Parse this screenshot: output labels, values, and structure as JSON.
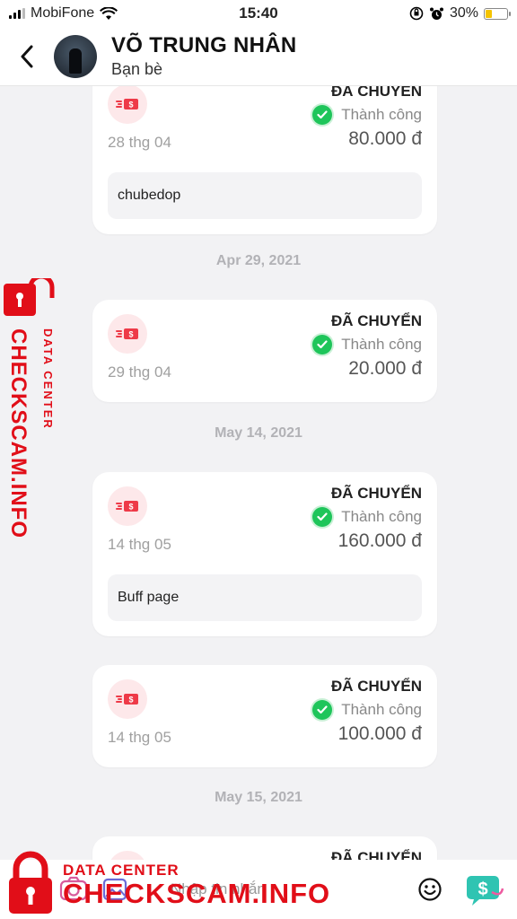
{
  "status_bar": {
    "carrier": "MobiFone",
    "time": "15:40",
    "battery": "30%",
    "battery_level": 0.3
  },
  "header": {
    "back_icon": "chevron-left-icon",
    "name": "VÕ TRUNG NHÂN",
    "relation": "Bạn bè"
  },
  "transactions": [
    {
      "type": "ĐÃ CHUYỂN",
      "status": "Thành công",
      "amount": "80.000 đ",
      "date": "28 thg 04",
      "note": "chubedop"
    },
    {
      "type": "ĐÃ CHUYỂN",
      "status": "Thành công",
      "amount": "20.000 đ",
      "date": "29 thg 04",
      "note": ""
    },
    {
      "type": "ĐÃ CHUYỂN",
      "status": "Thành công",
      "amount": "160.000 đ",
      "date": "14 thg 05",
      "note": "Buff page"
    },
    {
      "type": "ĐÃ CHUYỂN",
      "status": "Thành công",
      "amount": "100.000 đ",
      "date": "14 thg 05",
      "note": ""
    },
    {
      "type": "ĐÃ CHUYỂN",
      "status": "",
      "amount": "",
      "date": "",
      "note": ""
    }
  ],
  "date_separators": [
    "Apr 29, 2021",
    "May 14, 2021",
    "May 15, 2021"
  ],
  "input_bar": {
    "placeholder": "Nhập tin nhắn",
    "icons": [
      "camera-icon",
      "image-icon",
      "emoji-icon",
      "money-transfer-icon"
    ]
  },
  "watermark": {
    "line1": "DATA CENTER",
    "line2": "CHECKSCAM.INFO"
  },
  "colors": {
    "accent_red": "#e10e18",
    "success_green": "#1ec55a",
    "money_teal": "#2fc4b2"
  }
}
